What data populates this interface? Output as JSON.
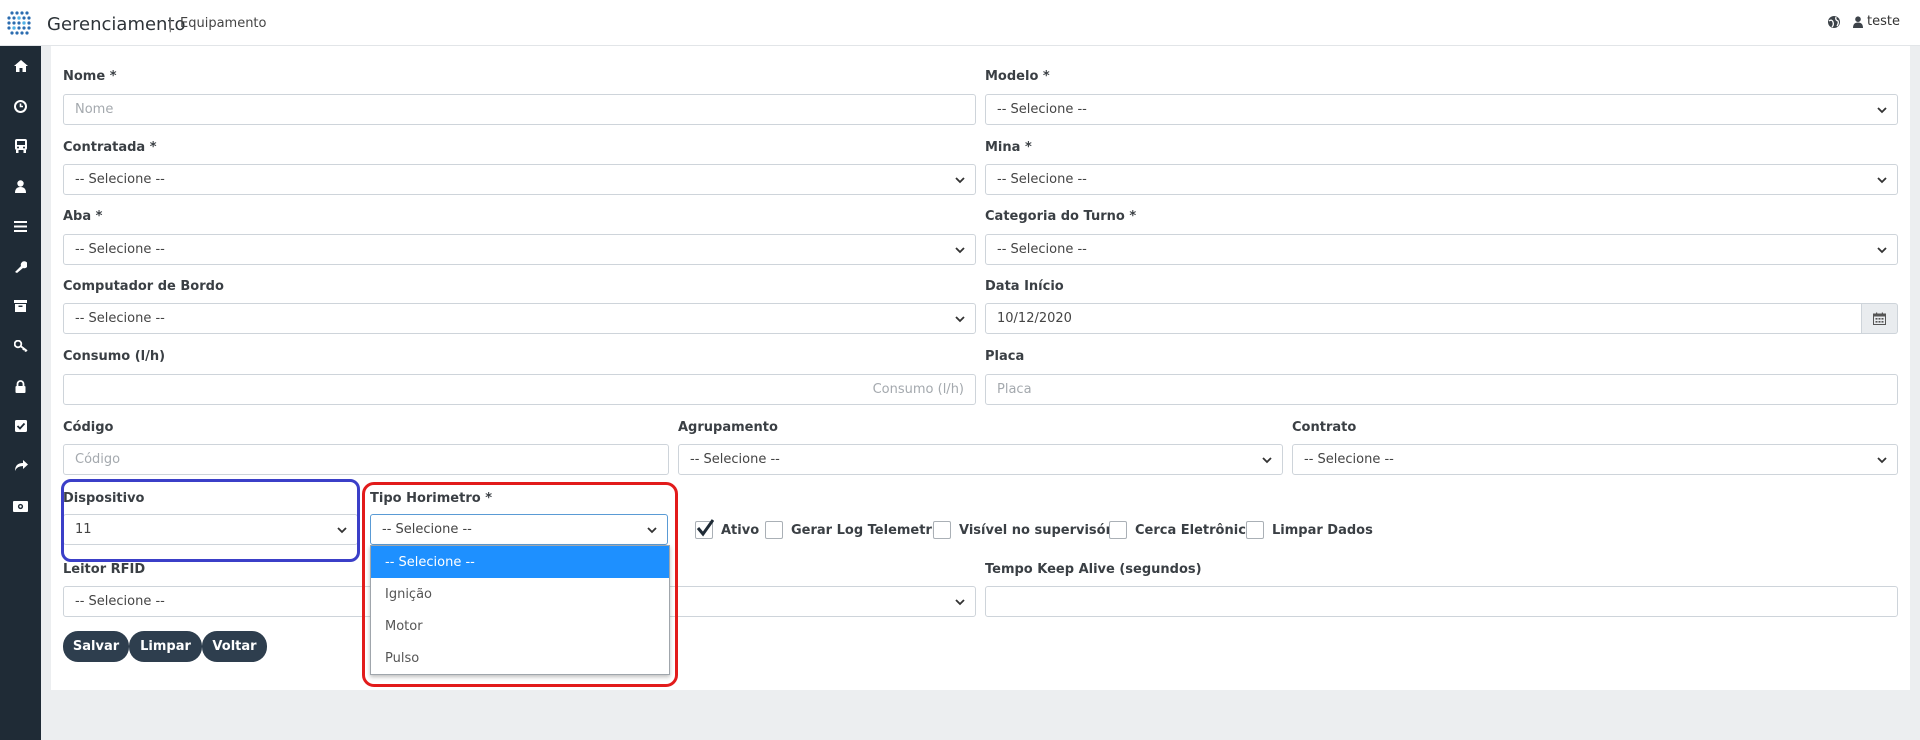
{
  "header": {
    "app_title": "Gerenciamento",
    "separator": "|",
    "breadcrumb": "Equipamento",
    "user": "teste",
    "globe_icon": "globe-icon",
    "user_icon": "user-icon"
  },
  "sidebar": {
    "items": [
      "home-icon",
      "clock-icon",
      "bus-icon",
      "user-icon",
      "menu-icon",
      "wrench-icon",
      "archive-icon",
      "key-icon",
      "lock-icon",
      "checkbox-icon",
      "share-icon",
      "money-icon"
    ]
  },
  "form": {
    "nome": {
      "label": "Nome *",
      "placeholder": "Nome"
    },
    "modelo": {
      "label": "Modelo *",
      "value": "-- Selecione --"
    },
    "contratada": {
      "label": "Contratada *",
      "value": "-- Selecione --"
    },
    "mina": {
      "label": "Mina *",
      "value": "-- Selecione --"
    },
    "aba": {
      "label": "Aba *",
      "value": "-- Selecione --"
    },
    "categoria_turno": {
      "label": "Categoria do Turno *",
      "value": "-- Selecione --"
    },
    "computador_bordo": {
      "label": "Computador de Bordo",
      "value": "-- Selecione --"
    },
    "data_inicio": {
      "label": "Data Início",
      "value": "10/12/2020"
    },
    "consumo": {
      "label": "Consumo (l/h)",
      "placeholder": "Consumo (l/h)"
    },
    "placa": {
      "label": "Placa",
      "placeholder": "Placa"
    },
    "codigo": {
      "label": "Código",
      "placeholder": "Código"
    },
    "agrupamento": {
      "label": "Agrupamento",
      "value": "-- Selecione --"
    },
    "contrato": {
      "label": "Contrato",
      "value": "-- Selecione --"
    },
    "dispositivo": {
      "label": "Dispositivo",
      "value": "11"
    },
    "tipo_horimetro": {
      "label": "Tipo Horimetro *",
      "value": "-- Selecione --",
      "options": [
        "-- Selecione --",
        "Ignição",
        "Motor",
        "Pulso"
      ]
    },
    "checkboxes": [
      {
        "label": "Ativo",
        "checked": true
      },
      {
        "label": "Gerar Log Telemetria",
        "checked": false
      },
      {
        "label": "Visível no supervisório",
        "checked": false
      },
      {
        "label": "Cerca Eletrônica",
        "checked": false
      },
      {
        "label": "Limpar Dados",
        "checked": false
      }
    ],
    "leitor_rfid": {
      "label": "Leitor RFID",
      "value": "-- Selecione --"
    },
    "tempo_keep_alive": {
      "label": "Tempo Keep Alive (segundos)",
      "value": ""
    }
  },
  "buttons": {
    "save": "Salvar",
    "clear": "Limpar",
    "back": "Voltar"
  },
  "colors": {
    "sidebar": "#1f2b36",
    "button": "#2e3e4e",
    "selected_option": "#1e90ff",
    "highlight_blue": "#3b3fc8",
    "highlight_red": "#e21b1b"
  }
}
